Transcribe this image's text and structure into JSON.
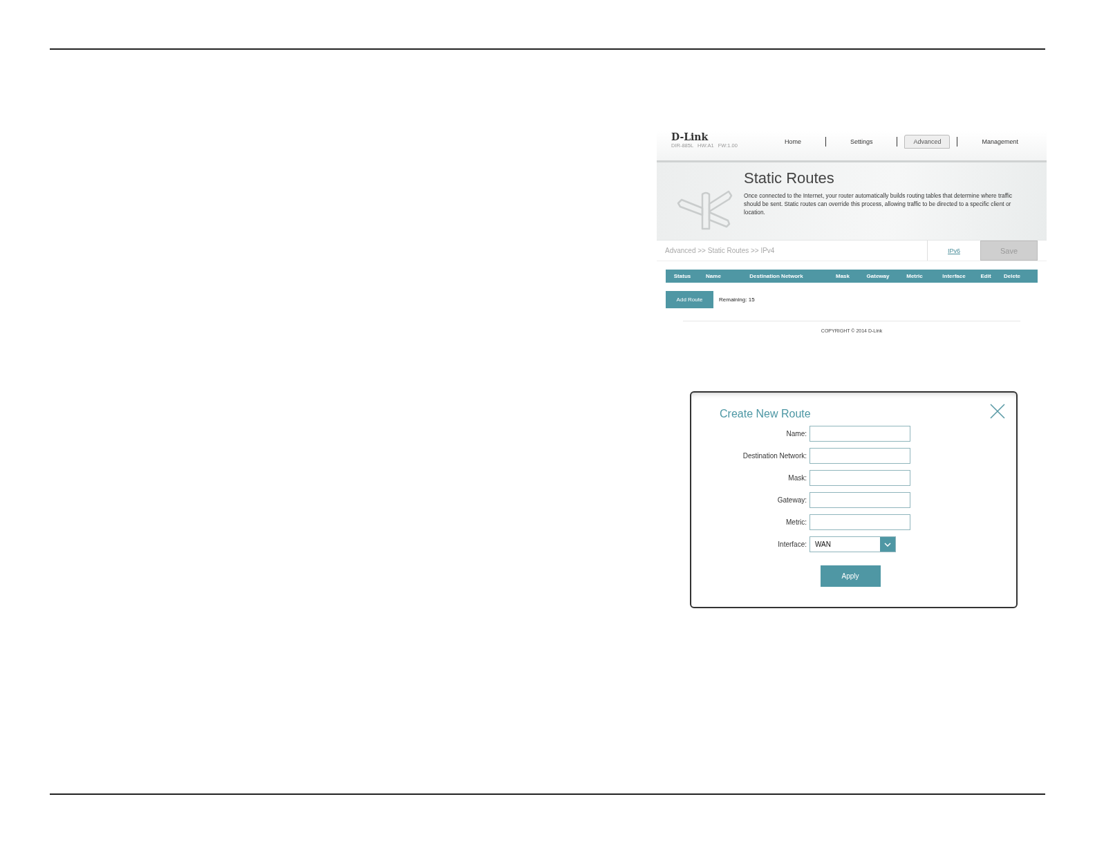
{
  "brand": {
    "logo": "D-Link",
    "model": "DIR-885L",
    "hw": "HW:A1",
    "fw": "FW:1.00"
  },
  "nav": [
    {
      "label": "Home",
      "selected": false
    },
    {
      "label": "Settings",
      "selected": false
    },
    {
      "label": "Advanced",
      "selected": true
    },
    {
      "label": "Management",
      "selected": false
    }
  ],
  "header": {
    "title": "Static Routes",
    "description": "Once connected to the Internet, your router automatically builds routing tables that determine where traffic should be sent. Static routes can override this process, allowing traffic to be directed to a specific client or location."
  },
  "breadcrumb": "Advanced >> Static Routes >> IPv4",
  "ipv6_link": "IPv6",
  "save_button": {
    "label": "Save",
    "disabled": true
  },
  "table": {
    "columns": [
      "Status",
      "Name",
      "Destination Network",
      "Mask",
      "Gateway",
      "Metric",
      "Interface",
      "Edit",
      "Delete"
    ]
  },
  "add_route_button": "Add Route",
  "remaining": "Remaining: 15",
  "copyright": "COPYRIGHT © 2014 D-Link",
  "dialog": {
    "title": "Create New Route",
    "fields": [
      {
        "label": "Name:",
        "kind": "text"
      },
      {
        "label": "Destination Network:",
        "kind": "text"
      },
      {
        "label": "Mask:",
        "kind": "text"
      },
      {
        "label": "Gateway:",
        "kind": "text"
      },
      {
        "label": "Metric:",
        "kind": "text"
      },
      {
        "label": "Interface:",
        "kind": "select",
        "value": "WAN"
      }
    ],
    "apply_button": "Apply"
  }
}
